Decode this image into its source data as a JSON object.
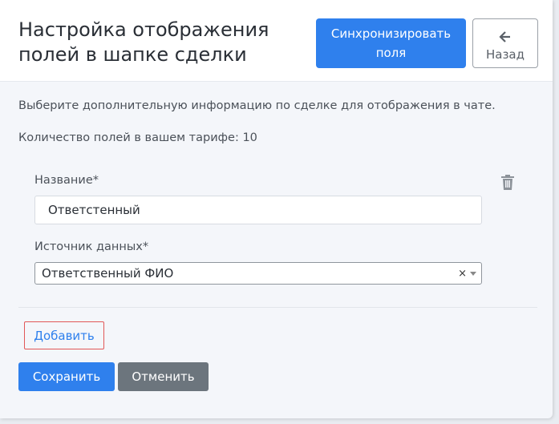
{
  "header": {
    "title": "Настройка отображения полей в шапке сделки",
    "sync_button": "Синхронизировать поля",
    "back_button": "Назад"
  },
  "main": {
    "description": "Выберите дополнительную информацию по сделке для отображения в чате.",
    "fields_count_text": "Количество полей в вашем тарифе: 10",
    "field": {
      "name_label": "Название*",
      "name_value": "Ответстенный",
      "source_label": "Источник данных*",
      "source_value": "Ответственный ФИО",
      "clear_symbol": "×"
    },
    "add_button": "Добавить",
    "save_button": "Сохранить",
    "cancel_button": "Отменить"
  },
  "colors": {
    "primary": "#2f80ed",
    "secondary": "#6c757d",
    "highlight_border": "#e15757"
  },
  "icons": {
    "back": "arrow-left-icon",
    "delete": "trash-icon",
    "dropdown": "caret-down-icon"
  }
}
